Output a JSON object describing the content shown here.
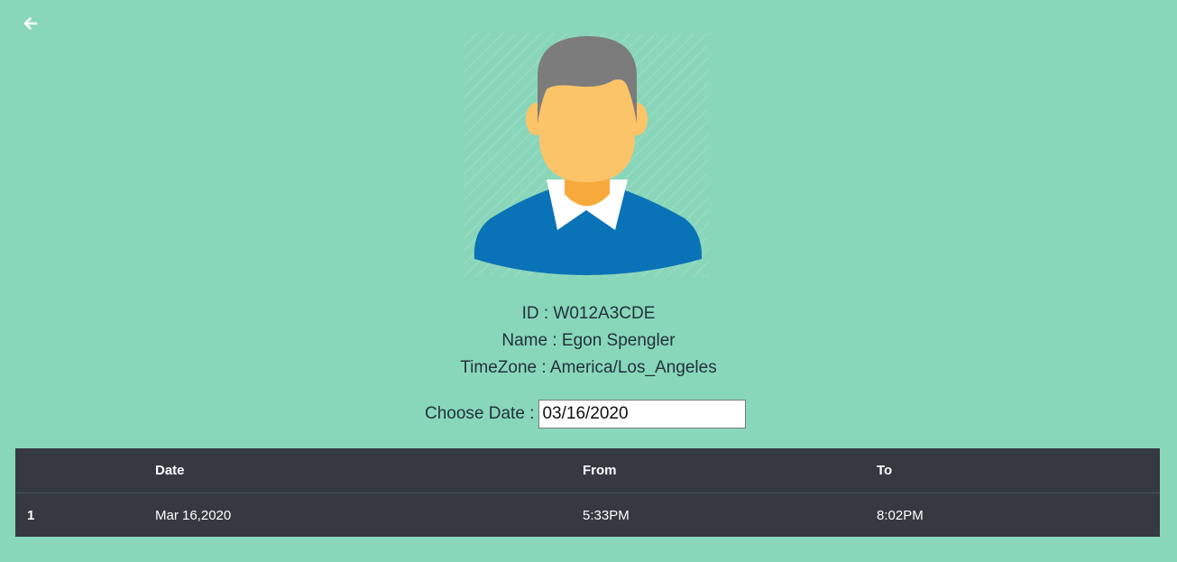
{
  "nav": {
    "back_icon": "arrow-left-icon"
  },
  "profile": {
    "avatar_icon": "user-avatar-icon",
    "id_text": "ID : W012A3CDE",
    "name_text": "Name : Egon Spengler",
    "timezone_text": "TimeZone : America/Los_Angeles"
  },
  "date_picker": {
    "label": "Choose Date :",
    "value": "03/16/2020"
  },
  "table": {
    "headers": [
      "",
      "Date",
      "From",
      "To"
    ],
    "rows": [
      [
        "1",
        "Mar 16,2020",
        "5:33PM",
        "8:02PM"
      ]
    ]
  },
  "colors": {
    "background": "#88d7bb",
    "table_bg": "#343a40",
    "shirt": "#0a73b7",
    "hair": "#7c7c7c",
    "skin": "#fcc468"
  }
}
